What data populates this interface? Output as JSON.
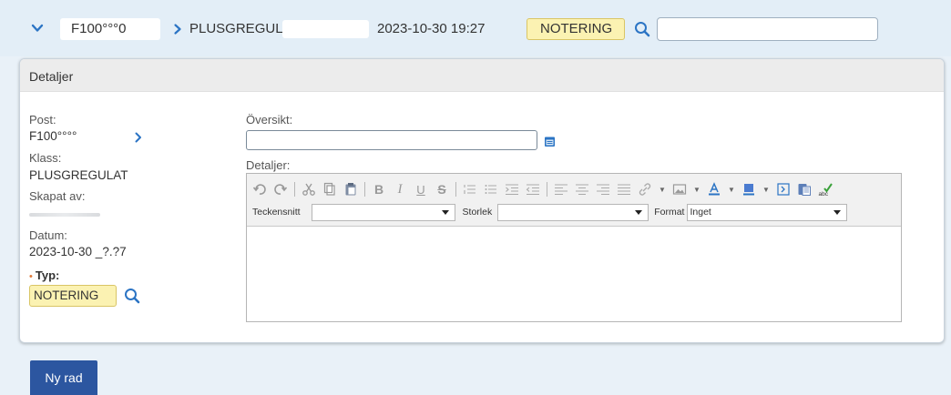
{
  "header_row": {
    "post_value": "F100°°°0",
    "klass_value": "PLUSGREGULAT",
    "date_value": "2023-10-30 19:27",
    "typ_value": "NOTERING",
    "search_value": ""
  },
  "details": {
    "title": "Detaljer",
    "post_label": "Post:",
    "post_value": "F100°°°°",
    "klass_label": "Klass:",
    "klass_value": "PLUSGREGULAT",
    "skapat_label": "Skapat av:",
    "datum_label": "Datum:",
    "datum_value": "2023-10-30 _?.?7",
    "typ_label": "Typ:",
    "typ_required": "•",
    "typ_value": "NOTERING",
    "oversikt_label": "Översikt:",
    "oversikt_value": "",
    "detaljer_label": "Detaljer:",
    "editor": {
      "font_label": "Teckensnitt",
      "font_value": "",
      "size_label": "Storlek",
      "size_value": "",
      "format_label": "Format",
      "format_value": "Inget",
      "content": ""
    }
  },
  "actions": {
    "new_row_label": "Ny rad"
  },
  "icons": [
    "chevron-down-icon",
    "chevron-right-icon",
    "search-icon",
    "calendar-icon",
    "undo-icon",
    "redo-icon",
    "cut-icon",
    "copy-icon",
    "paste-icon",
    "bold-icon",
    "italic-icon",
    "underline-icon",
    "strikethrough-icon",
    "ordered-list-icon",
    "bullet-list-icon",
    "indent-icon",
    "outdent-icon",
    "align-left-icon",
    "align-center-icon",
    "align-right-icon",
    "justify-icon",
    "link-icon",
    "image-icon",
    "text-color-icon",
    "background-color-icon",
    "source-icon",
    "paste-word-icon",
    "spellcheck-icon"
  ],
  "colors": {
    "page_bg": "#e9f1f8",
    "accent": "#2c56a0",
    "highlight": "#fbf2b2",
    "icon_blue": "#2b74c4"
  }
}
